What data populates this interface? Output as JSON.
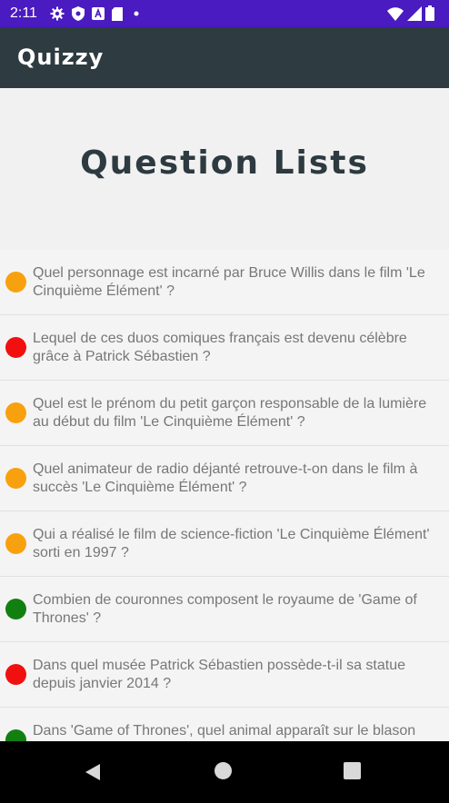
{
  "status_bar": {
    "time": "2:11",
    "left_icons": [
      "gear-icon",
      "shield-icon",
      "a-badge-icon",
      "sd-card-icon",
      "dot-icon"
    ],
    "right_icons": [
      "wifi-icon",
      "signal-icon",
      "battery-icon"
    ],
    "color": "#4a1bc0"
  },
  "app_bar": {
    "title": "Quizzy",
    "color": "#2e3b40"
  },
  "header": {
    "title": "Question Lists"
  },
  "questions": [
    {
      "text": "Quel personnage est incarné par Bruce Willis dans le film 'Le\nCinquième Élément' ?",
      "color": "#f8a10f"
    },
    {
      "text": "Lequel de ces duos comiques français est devenu célèbre\ngrâce à Patrick Sébastien ?",
      "color": "#f20f0f"
    },
    {
      "text": "Quel est le prénom du petit garçon responsable de la lumière\nau début du film 'Le Cinquième Élément' ?",
      "color": "#f8a10f"
    },
    {
      "text": "Quel animateur de radio déjanté retrouve-t-on dans le film à\nsuccès 'Le Cinquième Élément' ?",
      "color": "#f8a10f"
    },
    {
      "text": "Qui a réalisé le film de science-fiction 'Le Cinquième Élément'\nsorti en 1997 ?",
      "color": "#f8a10f"
    },
    {
      "text": "Combien de couronnes composent le royaume de 'Game of\nThrones' ?",
      "color": "#118011"
    },
    {
      "text": "Dans quel musée Patrick Sébastien possède-t-il sa statue\ndepuis janvier 2014 ?",
      "color": "#f20f0f"
    },
    {
      "text": "Dans 'Game of Thrones', quel animal apparaît sur le blason",
      "color": "#118011"
    }
  ],
  "nav_bar": {
    "buttons": [
      "back-icon",
      "home-icon",
      "recents-icon"
    ]
  }
}
